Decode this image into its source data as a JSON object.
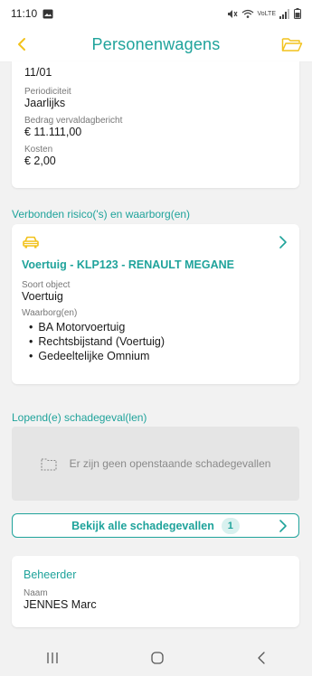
{
  "status_bar": {
    "time": "11:10",
    "network": "VoLTE"
  },
  "app_bar": {
    "title": "Personenwagens"
  },
  "payment_card": {
    "partial_value": "11/01",
    "periodicity_label": "Periodiciteit",
    "periodicity_value": "Jaarlijks",
    "amount_label": "Bedrag vervaldagbericht",
    "amount_value": "€ 11.111,00",
    "costs_label": "Kosten",
    "costs_value": "€ 2,00"
  },
  "risks_section": {
    "title": "Verbonden risico('s) en waarborg(en)",
    "vehicle_title": "Voertuig - KLP123 - RENAULT MEGANE",
    "object_type_label": "Soort object",
    "object_type_value": "Voertuig",
    "guarantees_label": "Waarborg(en)",
    "guarantees": [
      "BA Motorvoertuig",
      "Rechtsbijstand (Voertuig)",
      "Gedeeltelijke Omnium"
    ]
  },
  "claims_section": {
    "title": "Lopend(e) schadegeval(len)",
    "empty_text": "Er zijn geen openstaande schadegevallen",
    "view_all_label": "Bekijk alle schadegevallen",
    "count": "1"
  },
  "manager_card": {
    "title": "Beheerder",
    "name_label": "Naam",
    "name_value": "JENNES Marc"
  },
  "colors": {
    "accent": "#1fa39b",
    "icon_yellow": "#f2c21c"
  }
}
